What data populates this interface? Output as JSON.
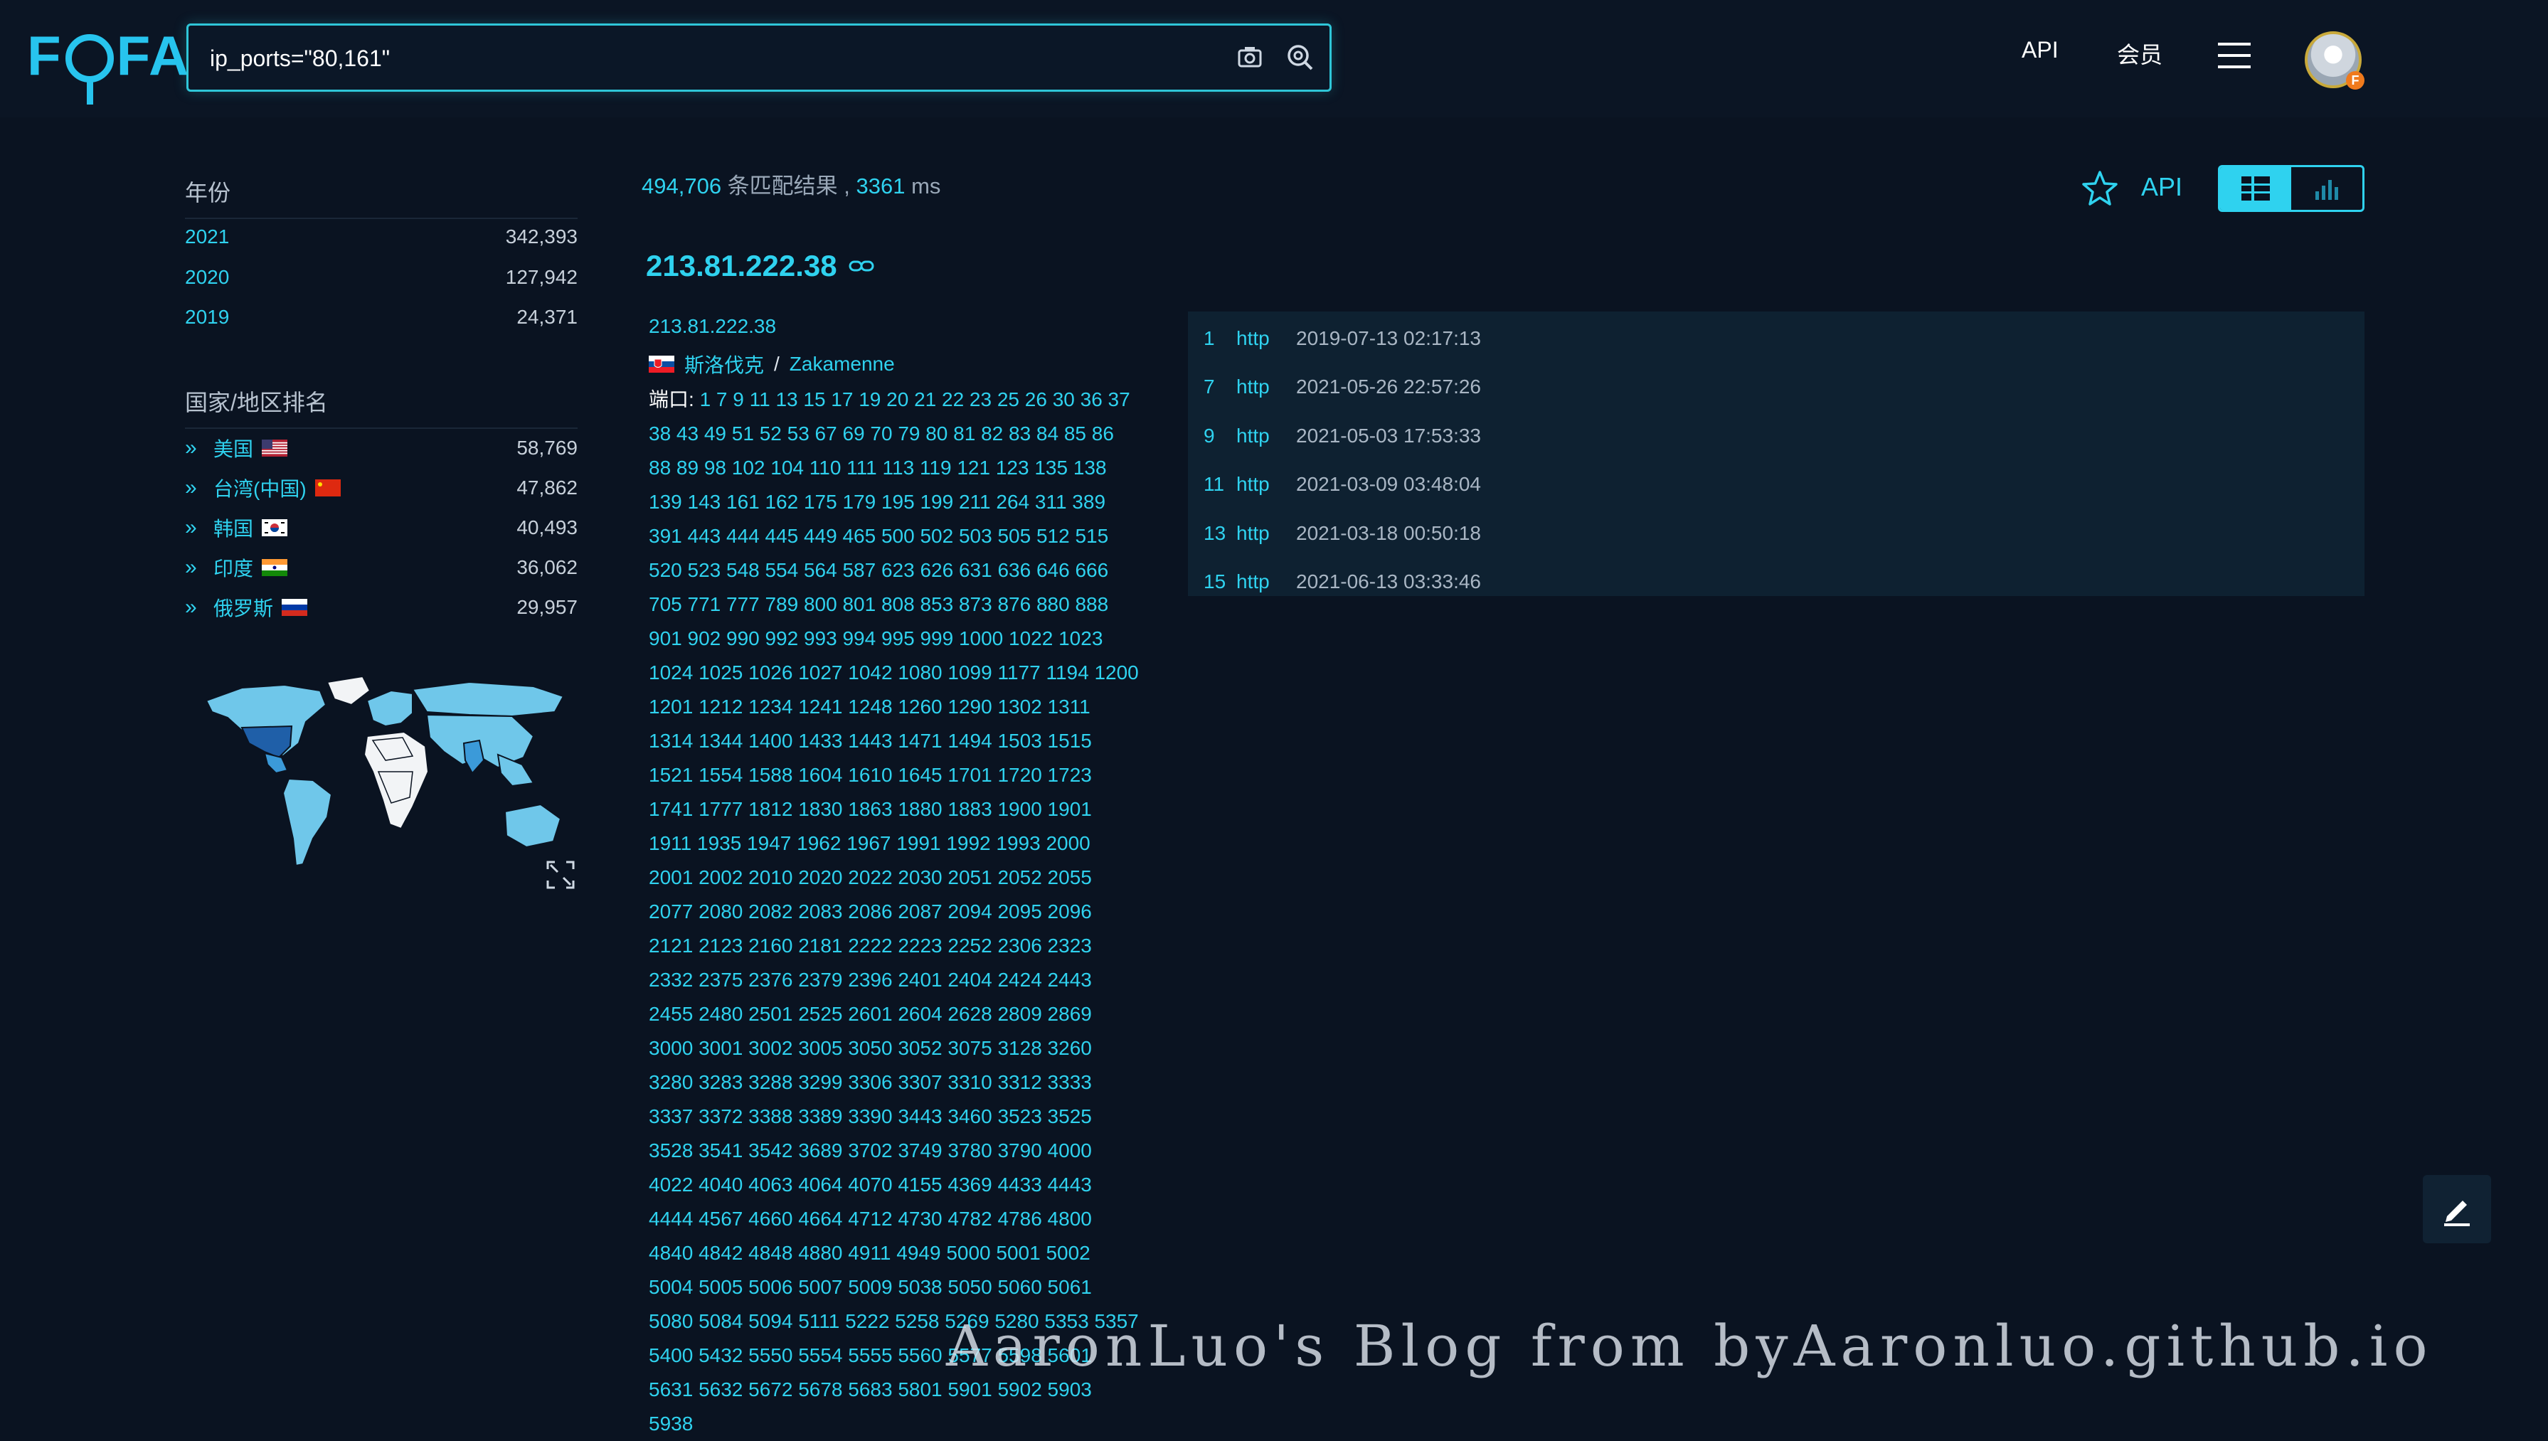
{
  "header": {
    "logo": "FOFA",
    "search_value": "ip_ports=\"80,161\"",
    "nav_api": "API",
    "nav_member": "会员",
    "avatar_badge": "F"
  },
  "sidebar": {
    "year_title": "年份",
    "years": [
      {
        "label": "2021",
        "count": "342,393"
      },
      {
        "label": "2020",
        "count": "127,942"
      },
      {
        "label": "2019",
        "count": "24,371"
      }
    ],
    "country_title": "国家/地区排名",
    "countries": [
      {
        "label": "美国",
        "flag": "us-flag",
        "count": "58,769"
      },
      {
        "label": "台湾(中国)",
        "flag": "cn-flag",
        "count": "47,862"
      },
      {
        "label": "韩国",
        "flag": "kr-flag",
        "count": "40,493"
      },
      {
        "label": "印度",
        "flag": "in-flag",
        "count": "36,062"
      },
      {
        "label": "俄罗斯",
        "flag": "ru-flag",
        "count": "29,957"
      }
    ]
  },
  "summary": {
    "count": "494,706",
    "count_text": " 条匹配结果 , ",
    "time": "3361",
    "time_unit": " ms"
  },
  "result": {
    "ip": "213.81.222.38",
    "ip_link": "213.81.222.38",
    "country": "斯洛伐克",
    "separator": "/",
    "city": "Zakamenne",
    "ports_label": "端口:",
    "ports": "1 7 9 11 13 15 17 19 20 21 22 23 25 26 30 36 37 38 43 49 51 52 53 67 69 70 79 80 81 82 83 84 85 86 88 89 98 102 104 110 111 113 119 121 123 135 138 139 143 161 162 175 179 195 199 211 264 311 389 391 443 444 445 449 465 500 502 503 505 512 515 520 523 548 554 564 587 623 626 631 636 646 666 705 771 777 789 800 801 808 853 873 876 880 888 901 902 990 992 993 994 995 999 1000 1022 1023 1024 1025 1026 1027 1042 1080 1099 1177 1194 1200 1201 1212 1234 1241 1248 1260 1290 1302 1311 1314 1344 1400 1433 1443 1471 1494 1503 1515 1521 1554 1588 1604 1610 1645 1701 1720 1723 1741 1777 1812 1830 1863 1880 1883 1900 1901 1911 1935 1947 1962 1967 1991 1992 1993 2000 2001 2002 2010 2020 2022 2030 2051 2052 2055 2077 2080 2082 2083 2086 2087 2094 2095 2096 2121 2123 2160 2181 2222 2223 2252 2306 2323 2332 2375 2376 2379 2396 2401 2404 2424 2443 2455 2480 2501 2525 2601 2604 2628 2809 2869 3000 3001 3002 3005 3050 3052 3075 3128 3260 3280 3283 3288 3299 3306 3307 3310 3312 3333 3337 3372 3388 3389 3390 3443 3460 3523 3525 3528 3541 3542 3689 3702 3749 3780 3790 4000 4022 4040 4063 4064 4070 4155 4369 4433 4443 4444 4567 4660 4664 4712 4730 4782 4786 4800 4840 4842 4848 4880 4911 4949 5000 5001 5002 5004 5005 5006 5007 5009 5038 5050 5060 5061 5080 5084 5094 5111 5222 5258 5269 5280 5353 5357 5400 5432 5550 5554 5555 5560 5577 5598 5601 5631 5632 5672 5678 5683 5801 5901 5902 5903 5938"
  },
  "right": {
    "api_label": "API",
    "history": [
      {
        "no": "1",
        "proto": "http",
        "time": "2019-07-13 02:17:13"
      },
      {
        "no": "7",
        "proto": "http",
        "time": "2021-05-26 22:57:26"
      },
      {
        "no": "9",
        "proto": "http",
        "time": "2021-05-03 17:53:33"
      },
      {
        "no": "11",
        "proto": "http",
        "time": "2021-03-09 03:48:04"
      },
      {
        "no": "13",
        "proto": "http",
        "time": "2021-03-18 00:50:18"
      },
      {
        "no": "15",
        "proto": "http",
        "time": "2021-06-13 03:33:46"
      }
    ]
  },
  "watermark": "AaronLuo's Blog from byAaronluo.github.io",
  "colors": {
    "accent": "#2fd2ef",
    "background": "#0a1321"
  }
}
